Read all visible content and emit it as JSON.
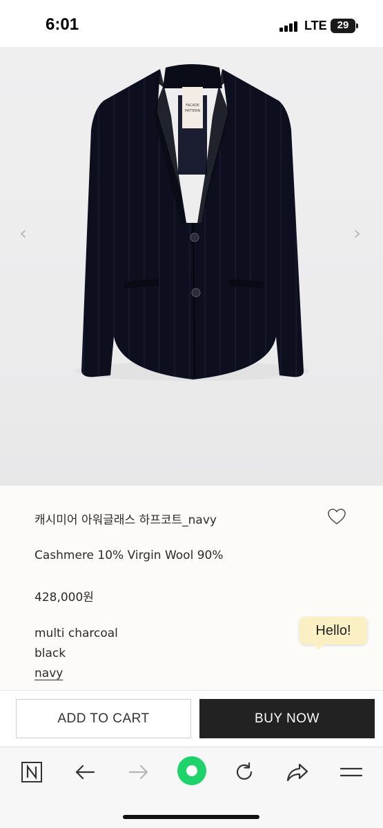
{
  "status_bar": {
    "time": "6:01",
    "network": "LTE",
    "battery": "29"
  },
  "product": {
    "image_icon": "jacket-photo",
    "title": "캐시미어 아워글래스 하프코트_navy",
    "material": "Cashmere 10% Virgin Wool 90%",
    "price": "428,000원",
    "label_text": "FACADE PATTERN",
    "colors": [
      "multi charcoal",
      "black",
      "navy"
    ],
    "selected_color": "navy",
    "wishlist_icon": "heart-icon"
  },
  "chat_bubble": {
    "text": "Hello!"
  },
  "actions": {
    "add_to_cart": "ADD TO CART",
    "buy_now": "BUY NOW"
  },
  "browser_toolbar": {
    "items": [
      "naver-home-icon",
      "back-icon",
      "forward-icon",
      "green-dot-icon",
      "reload-icon",
      "share-icon",
      "menu-icon"
    ],
    "accent_color": "#1ec800"
  }
}
